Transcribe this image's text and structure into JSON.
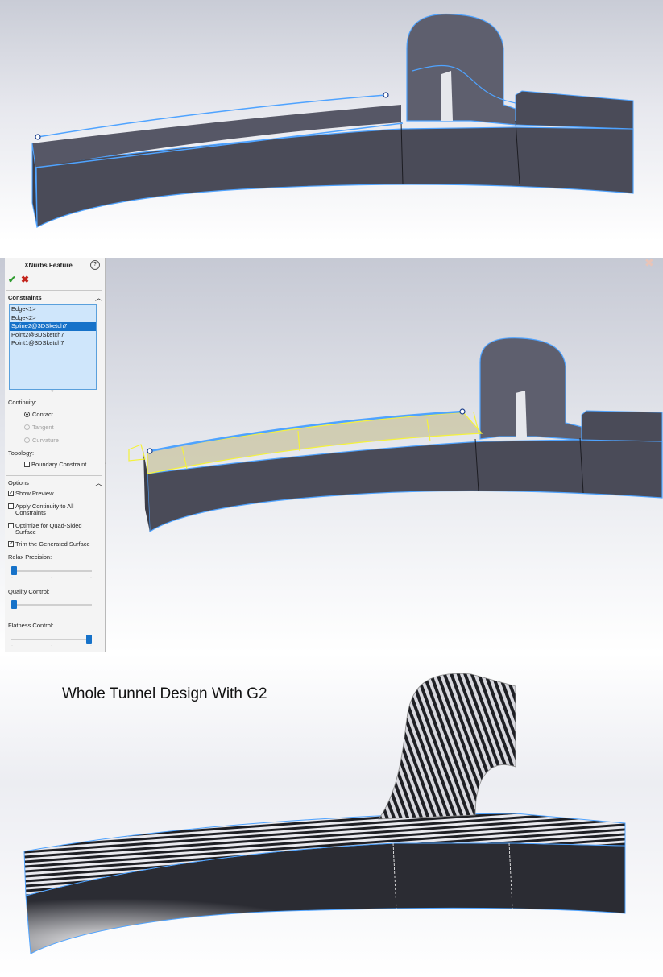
{
  "panels": {
    "top": "3D view - tunnel surface before fill",
    "middle": "3D view - XNurbs preview",
    "bottom": "3D view - zebra stripes analysis"
  },
  "property_manager": {
    "title": "XNurbs Feature",
    "help_icon": "?",
    "ok_icon": "✔",
    "cancel_icon": "✖",
    "constraints_label": "Constraints",
    "constraints": [
      "Edge<1>",
      "Edge<2>",
      "Spline2@3DSketch7",
      "Point2@3DSketch7",
      "Point1@3DSketch7"
    ],
    "selected_index": 2,
    "continuity_label": "Continuity:",
    "continuity_options": [
      "Contact",
      "Tangent",
      "Curvature"
    ],
    "continuity_selected": "Contact",
    "topology_label": "Topology:",
    "boundary_constraint_label": "Boundary Constraint",
    "boundary_constraint_checked": false,
    "options_label": "Options",
    "show_preview_label": "Show Preview",
    "show_preview_checked": true,
    "apply_continuity_label": "Apply Continuity to All Constraints",
    "apply_continuity_checked": false,
    "optimize_label": "Optimize for Quad-Sided Surface",
    "optimize_checked": false,
    "trim_label": "Trim the Generated Surface",
    "trim_checked": true,
    "relax_label": "Relax Precision:",
    "relax_value": 0.0,
    "quality_label": "Quality Control:",
    "quality_value": 0.0,
    "flatness_label": "Flatness Control:",
    "flatness_value": 1.0
  },
  "caption": "Whole Tunnel Design With G2",
  "colors": {
    "surface": "#4a4b58",
    "surface_light": "#7b7d8c",
    "edge": "#4fa3ff",
    "preview": "#f4f23b",
    "selection": "#1672c9"
  }
}
